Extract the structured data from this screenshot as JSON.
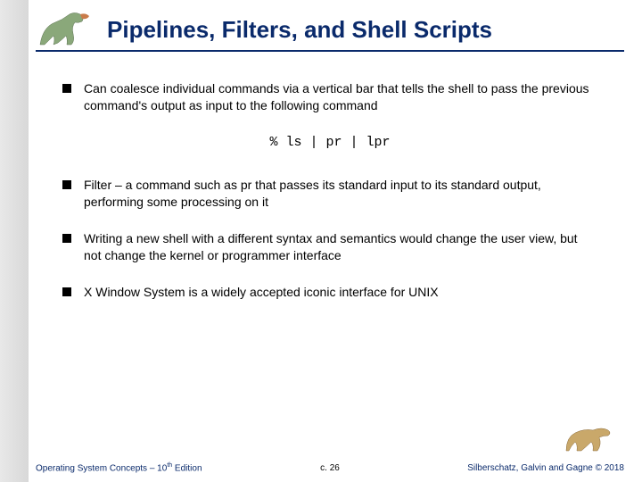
{
  "title": "Pipelines, Filters, and Shell Scripts",
  "bullets": [
    "Can coalesce individual commands via a vertical bar that tells the shell to pass the previous command's output as input to the following command",
    "Filter – a command such as pr that passes its standard input to its standard output, performing some processing on it",
    "Writing a new shell with a different syntax and semantics would change the user view, but not change the kernel or programmer interface",
    "X Window System is a widely accepted iconic interface for UNIX"
  ],
  "code": "% ls | pr | lpr",
  "footer": {
    "left_a": "Operating System Concepts – 10",
    "left_b": " Edition",
    "left_sup": "th",
    "center": "c. 26",
    "right": "Silberschatz, Galvin and Gagne © 2018"
  }
}
